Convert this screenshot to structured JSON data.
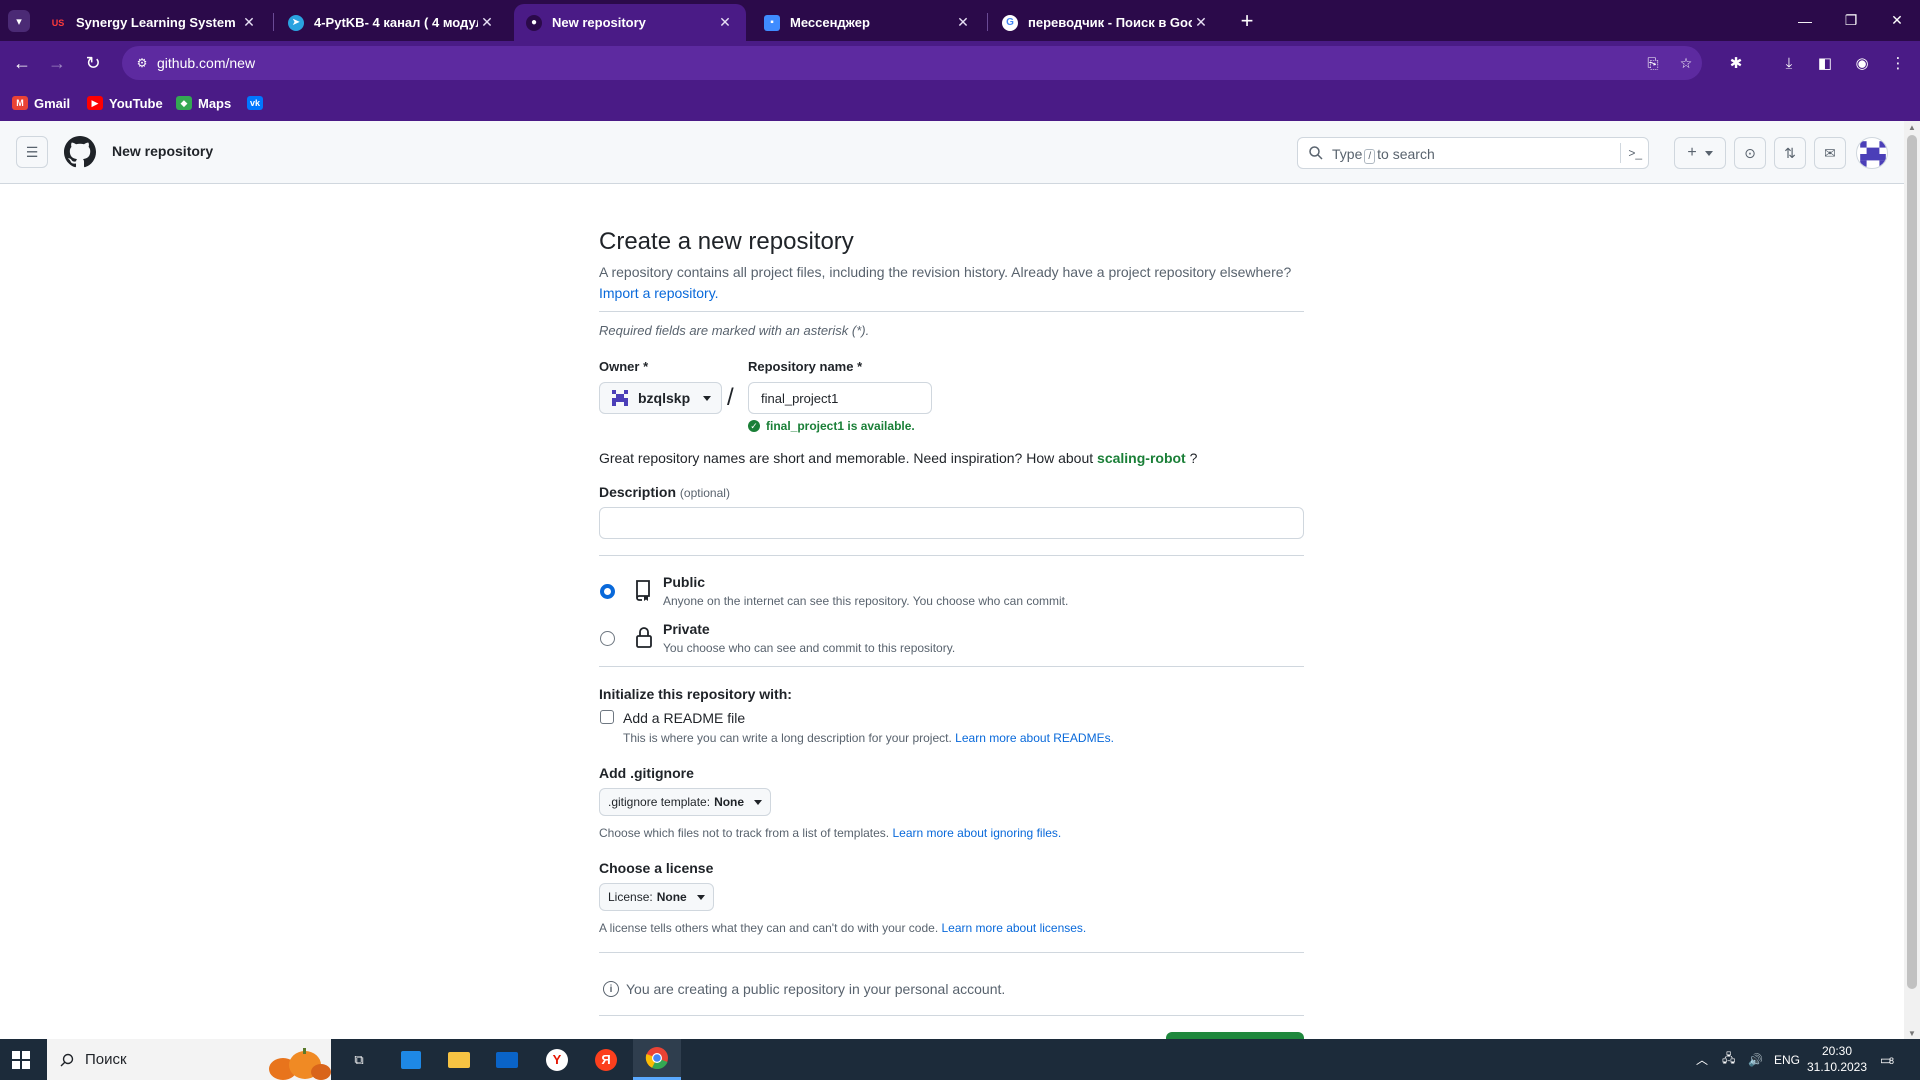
{
  "browser": {
    "tabs": [
      {
        "label": "Synergy Learning System",
        "icon": "synergy-favicon",
        "active": false
      },
      {
        "label": "4-PytKB- 4 канал ( 4 модуль)",
        "icon": "telegram-favicon",
        "active": false
      },
      {
        "label": "New repository",
        "icon": "github-favicon",
        "active": true
      },
      {
        "label": "Мессенджер",
        "icon": "messenger-favicon",
        "active": false
      },
      {
        "label": "переводчик - Поиск в Google",
        "icon": "google-favicon",
        "active": false
      }
    ],
    "url": "github.com/new",
    "bookmarks": [
      {
        "label": "Gmail",
        "icon": "gmail-icon"
      },
      {
        "label": "YouTube",
        "icon": "youtube-icon"
      },
      {
        "label": "Maps",
        "icon": "maps-icon"
      },
      {
        "label": "",
        "icon": "vk-icon"
      }
    ],
    "colors": {
      "tabbar": "#2b0a4a",
      "toolbar": "#4a1b86"
    }
  },
  "header": {
    "page_title": "New repository",
    "search_pre": "Type",
    "search_key": "/",
    "search_post": "to search",
    "create_label": "+"
  },
  "main": {
    "title": "Create a new repository",
    "lead": "A repository contains all project files, including the revision history. Already have a project repository elsewhere?",
    "import_link": "Import a repository.",
    "required_note": "Required fields are marked with an asterisk (*).",
    "owner_label": "Owner *",
    "owner_value": "bzqlskp",
    "slash": "/",
    "repo_label": "Repository name *",
    "repo_value": "final_project1",
    "availability": "final_project1 is available.",
    "inspire_pre": "Great repository names are short and memorable. Need inspiration? How about",
    "inspire_suggestion": "scaling-robot",
    "inspire_post": "?",
    "description_label": "Description",
    "description_optional": "(optional)",
    "description_value": "",
    "visibility": {
      "public_title": "Public",
      "public_desc": "Anyone on the internet can see this repository. You choose who can commit.",
      "private_title": "Private",
      "private_desc": "You choose who can see and commit to this repository.",
      "selected": "public"
    },
    "init_title": "Initialize this repository with:",
    "readme_label": "Add a README file",
    "readme_desc": "This is where you can write a long description for your project.",
    "readme_link": "Learn more about READMEs.",
    "readme_checked": false,
    "gitignore_title": "Add .gitignore",
    "gitignore_btn_prefix": ".gitignore template:",
    "gitignore_btn_value": "None",
    "gitignore_help": "Choose which files not to track from a list of templates.",
    "gitignore_link": "Learn more about ignoring files.",
    "license_title": "Choose a license",
    "license_btn_prefix": "License:",
    "license_btn_value": "None",
    "license_help": "A license tells others what they can and can't do with your code.",
    "license_link": "Learn more about licenses.",
    "info_text": "You are creating a public repository in your personal account.",
    "accent": "#0969da",
    "success": "#1a7f37",
    "button_green": "#1f883d"
  },
  "taskbar": {
    "search_placeholder": "Поиск",
    "apps": [
      "task-view-icon",
      "microsoft-store-icon",
      "file-explorer-icon",
      "mail-icon",
      "yandex-browser-icon",
      "yandex-icon",
      "chrome-icon"
    ],
    "lang": "ENG",
    "time": "20:30",
    "date": "31.10.2023",
    "notifications": "8"
  }
}
